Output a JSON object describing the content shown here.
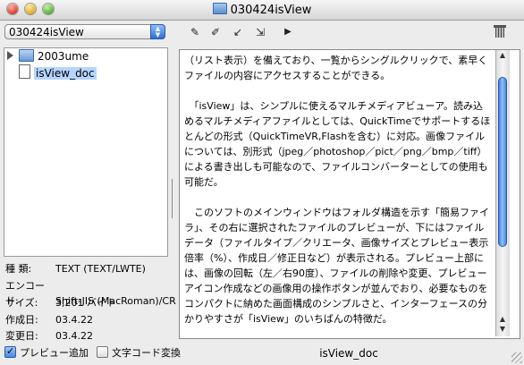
{
  "window": {
    "title": "030424isView"
  },
  "toolbar": {
    "path_value": "030424isView",
    "icons": [
      "edit-note-icon",
      "rename-icon",
      "move-icon",
      "copy-icon",
      "play-icon",
      "trash-icon"
    ]
  },
  "tree": {
    "items": [
      {
        "label": "2003ume",
        "type": "folder"
      },
      {
        "label": "isView_doc",
        "type": "document",
        "selected": true
      }
    ]
  },
  "info": {
    "rows": [
      {
        "key": "種 類:",
        "value": "TEXT (TEXT/LWTE)"
      },
      {
        "key": "エンコード:",
        "value": "Shift-JIS (MacRoman)/CR"
      },
      {
        "key": "サイズ:",
        "value": "3,201 バイト"
      },
      {
        "key": "作成日:",
        "value": "03.4.22"
      },
      {
        "key": "変更日:",
        "value": "03.4.22"
      }
    ]
  },
  "document": {
    "filename": "isView_doc",
    "text": "（リスト表示）を備えており、一覧からシングルクリックで、素早くファイルの内容にアクセスすることができる。\n\n　「isView」は、シンプルに使えるマルチメディアビューア。読み込めるマルチメディアファイルとしては、QuickTimeでサポートするほとんどの形式（QuickTimeVR,Flashを含む）に対応。画像ファイルについては、別形式（jpeg／photoshop／pict／png／bmp／tiff）による書き出しも可能なので、ファイルコンバーターとしての使用も可能だ。\n\n　このソフトのメインウィンドウはフォルダ構造を示す「簡易ファイラ」、その右に選択されたファイルのプレビューが、下にはファイルデータ（ファイルタイプ／クリエータ、画像サイズとプレビュー表示倍率（%）、作成日／修正日など）が表示される。プレビュー上部には、画像の回転（左／右90度）、ファイルの削除や変更、プレビューアイコン作成などの画像用の操作ボタンが並んでおり、必要なものをコンパクトに納めた画面構成のシンプルさと、インターフェースの分かりやすさが「isView」のいちばんの特徴だ。\n\n　ウィンドウのサイズ、ファイルリストの表示幅は、マウスドラッグによって変更可能。この場合、画像は自動的にリサイズ（表示倍率表示も再計算）される。「サムネール」など1ウィンドウ内に複数ファイルを表示させる機能はないが、ウィンドウを複数開くことは可能なので、異なるフォルダを同時に処理することはできる。たとえば、フォルダ別にウィンドウを開いておき、コピー／移動するといった操作が考えられる。"
  },
  "options": {
    "preview_add": {
      "label": "プレビュー追加",
      "checked": true
    },
    "char_convert": {
      "label": "文字コード変換",
      "checked": false
    }
  }
}
